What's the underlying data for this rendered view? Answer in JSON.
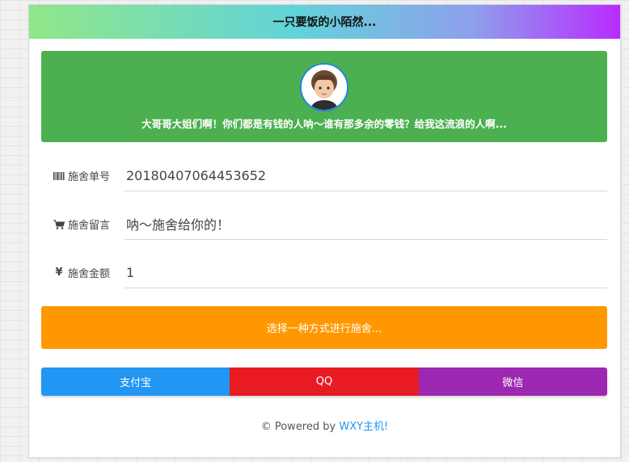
{
  "header": {
    "title": "一只要饭的小陌然..."
  },
  "banner": {
    "avatar_alt": "child-avatar",
    "message": "大哥哥大姐们啊！你们都是有钱的人呐～谁有那多余的零钱？给我这流浪的人啊..."
  },
  "form": {
    "order": {
      "label": "施舍单号",
      "icon": "barcode-icon",
      "value": "20180407064453652"
    },
    "message": {
      "label": "施舍留言",
      "icon": "cart-icon",
      "value": "呐～施舍给你的！"
    },
    "amount": {
      "label": "施舍金额",
      "icon": "yen-icon",
      "value": "1"
    }
  },
  "prompt_button": {
    "label": "选择一种方式进行施舍..."
  },
  "payment": {
    "alipay": {
      "label": "支付宝",
      "color": "#2196f3"
    },
    "qq": {
      "label": "QQ",
      "color": "#e81b23"
    },
    "wechat": {
      "label": "微信",
      "color": "#9c27b0"
    }
  },
  "footer": {
    "prefix": "© Powered by ",
    "link": "WXY主机!"
  },
  "colors": {
    "banner_green": "#4caf50",
    "orange": "#ff9800",
    "link_blue": "#2196f3"
  }
}
